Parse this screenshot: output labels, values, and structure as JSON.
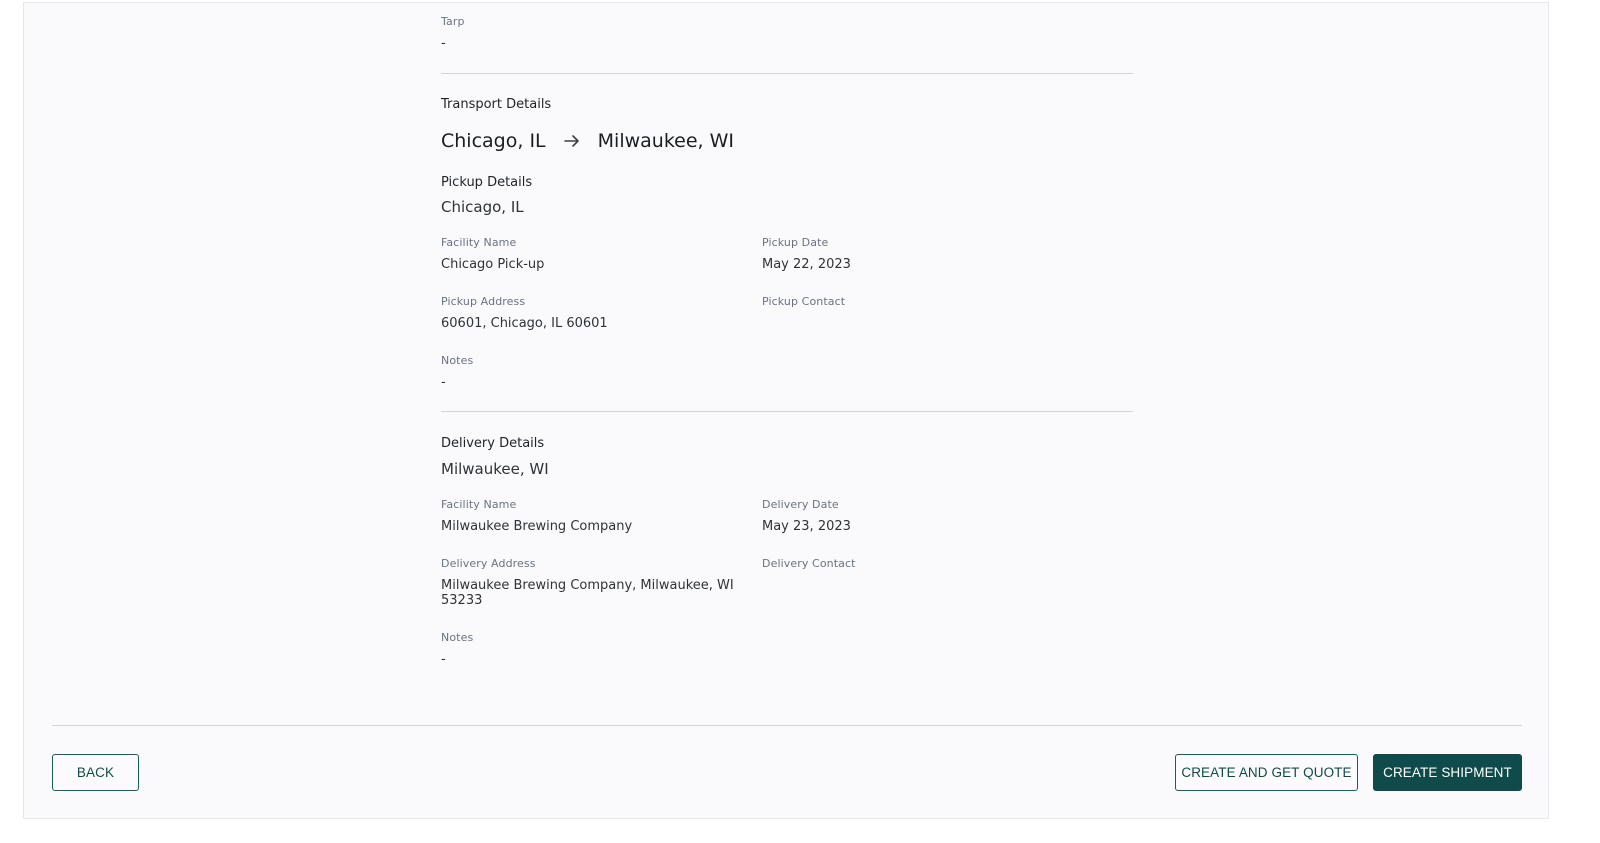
{
  "tarp": {
    "label": "Tarp",
    "value": "-"
  },
  "transport": {
    "title": "Transport Details",
    "origin": "Chicago, IL",
    "destination": "Milwaukee, WI",
    "arrow_icon": "arrow-right-icon"
  },
  "pickup": {
    "title": "Pickup Details",
    "city": "Chicago, IL",
    "facility_label": "Facility Name",
    "facility_value": "Chicago Pick-up",
    "date_label": "Pickup Date",
    "date_value": "May 22, 2023",
    "address_label": "Pickup Address",
    "address_value": "60601, Chicago, IL 60601",
    "contact_label": "Pickup Contact",
    "notes_label": "Notes",
    "notes_value": "-"
  },
  "delivery": {
    "title": "Delivery Details",
    "city": "Milwaukee, WI",
    "facility_label": "Facility Name",
    "facility_value": "Milwaukee Brewing Company",
    "date_label": "Delivery Date",
    "date_value": "May 23, 2023",
    "address_label": "Delivery Address",
    "address_line1": "Milwaukee Brewing Company, Milwaukee, WI",
    "address_line2": "53233",
    "contact_label": "Delivery Contact",
    "notes_label": "Notes",
    "notes_value": "-"
  },
  "footer": {
    "back_label": "BACK",
    "quote_label": "CREATE AND GET QUOTE",
    "create_label": "CREATE SHIPMENT"
  },
  "colors": {
    "primary": "#0f4b4a",
    "background": "#fafafd",
    "divider": "#d4d4d8"
  }
}
